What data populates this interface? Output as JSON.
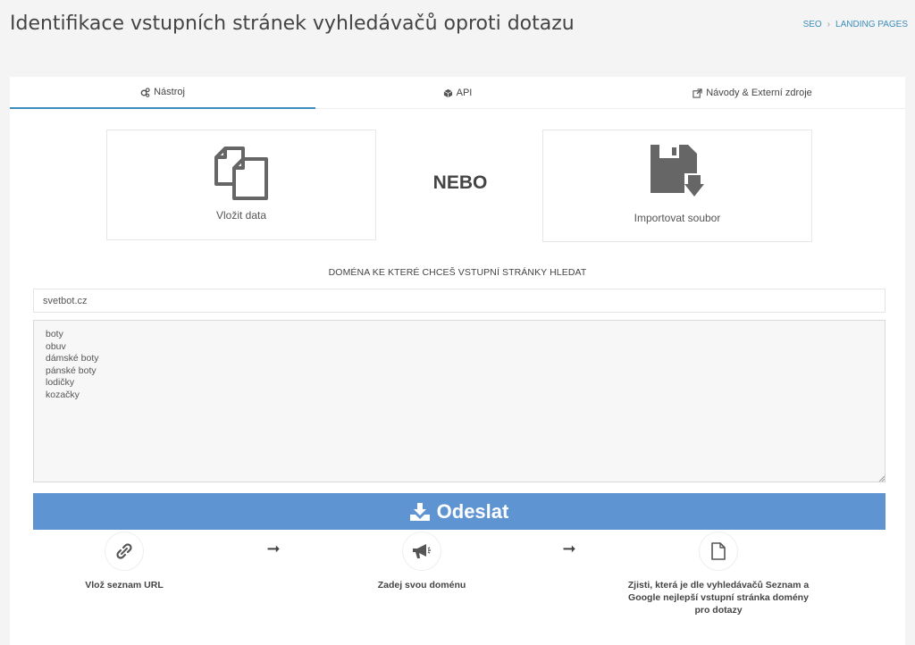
{
  "header": {
    "title": "Identifikace vstupních stránek vyhledávačů oproti dotazu",
    "breadcrumb": [
      "SEO",
      "LANDING PAGES"
    ]
  },
  "tabs": [
    {
      "label": "Nástroj",
      "icon": "gears-icon",
      "active": true
    },
    {
      "label": "API",
      "icon": "cube-icon",
      "active": false
    },
    {
      "label": "Návody & Externí zdroje",
      "icon": "external-link-icon",
      "active": false
    }
  ],
  "options": {
    "paste": {
      "label": "Vložit data",
      "icon": "copy-icon"
    },
    "import": {
      "label": "Importovat soubor",
      "icon": "floppy-download-icon"
    },
    "or_text": "NEBO"
  },
  "form": {
    "domain_label": "DOMÉNA KE KTERÉ CHCEŠ VSTUPNÍ STRÁNKY HLEDAT",
    "domain_value": "svetbot.cz",
    "keywords": "boty\nobuv\ndámské boty\npánské boty\nlodičky\nkozačky",
    "submit_label": "Odeslat",
    "accent_color": "#5e94d1"
  },
  "steps": [
    {
      "icon": "link-icon",
      "text": "Vlož seznam URL"
    },
    {
      "icon": "bullhorn-icon",
      "text": "Zadej svou doménu"
    },
    {
      "icon": "file-icon",
      "text": "Zjisti, která je dle vyhledávačů Seznam a Google nejlepší vstupní stránka domény pro dotazy"
    }
  ],
  "arrow_glyph": "➞"
}
